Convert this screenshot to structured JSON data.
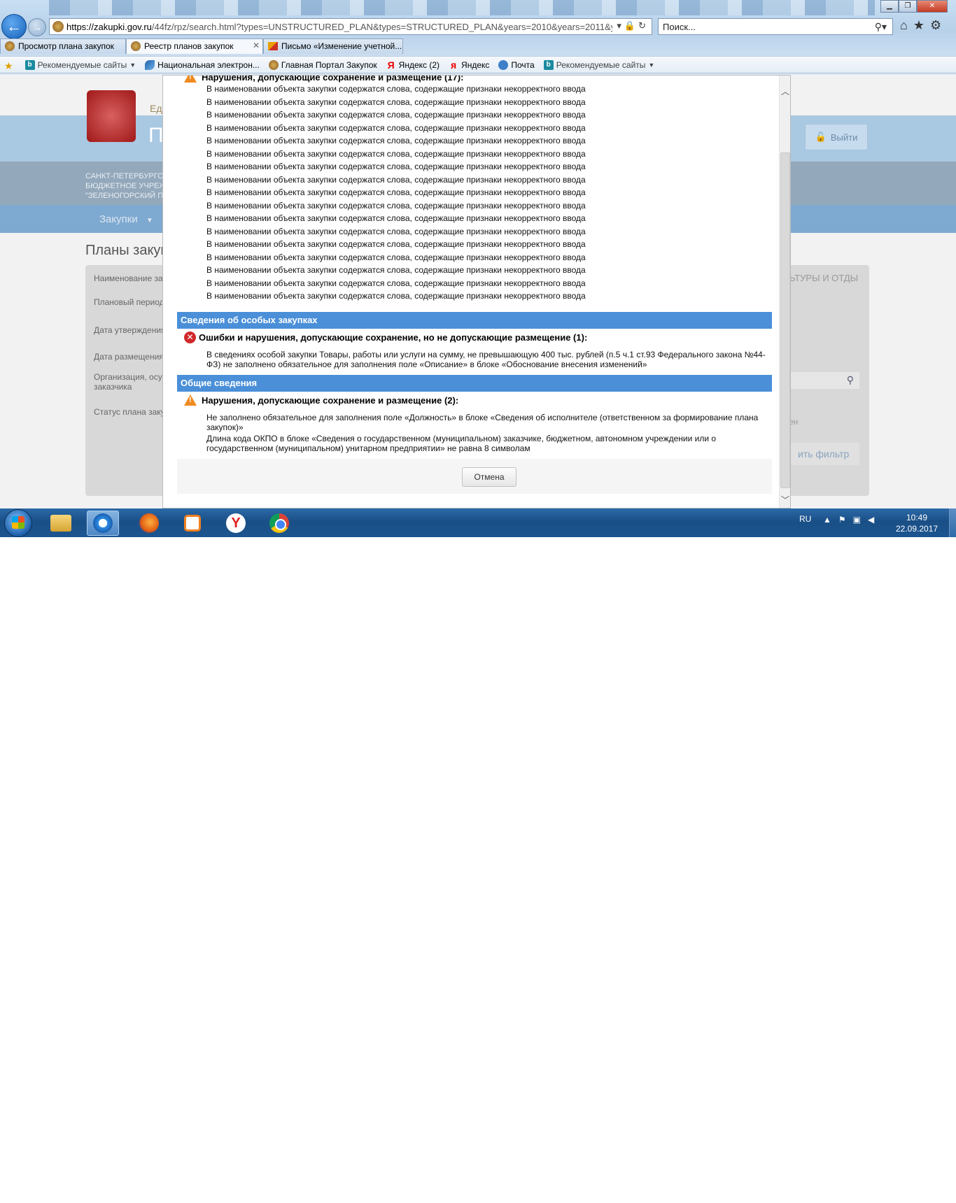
{
  "browser": {
    "url_host": "https://zakupki.gov.ru",
    "url_path": "/44fz/rpz/search.html?types=UNSTRUCTURED_PLAN&types=STRUCTURED_PLAN&years=2010&years=2011&years=2012&yea",
    "search_placeholder": "Поиск...",
    "tabs": [
      {
        "label": "Просмотр плана закупок",
        "active": false
      },
      {
        "label": "Реестр планов закупок",
        "active": true
      },
      {
        "label": "Письмо «Изменение учетной...",
        "active": false
      }
    ],
    "favorites": [
      {
        "label": "Рекомендуемые сайты",
        "icon": "bing-icon",
        "dropdown": true
      },
      {
        "label": "Национальная электрон...",
        "icon": "national-icon",
        "dropdown": false
      },
      {
        "label": "Главная Портал Закупок",
        "icon": "gerb-icon",
        "dropdown": false
      },
      {
        "label": "Яндекс (2)",
        "icon": "yandex-icon",
        "dropdown": false
      },
      {
        "label": "Яндекс",
        "icon": "yandex-icon",
        "dropdown": false
      },
      {
        "label": "Почта",
        "icon": "mail-icon",
        "dropdown": false
      },
      {
        "label": "Рекомендуемые сайты",
        "icon": "bing-icon",
        "dropdown": true
      }
    ]
  },
  "background_page": {
    "header_ed": "Ед",
    "header_p": "П",
    "logout_label": "Выйти",
    "org_lines": [
      "САНКТ-ПЕТЕРБУРГС",
      "БЮДЖЕТНОЕ УЧРЕЖ",
      "\"ЗЕЛЕНОГОРСКИЙ П"
    ],
    "menu_zakupki": "Закупки",
    "page_title": "Планы закуп",
    "filter_labels": [
      "Наименование зак",
      "Плановый период",
      "Дата утверждения",
      "Дата размещения",
      "Организация, осу",
      "заказчика",
      "Статус плана заку"
    ],
    "filter_right_text": "ЬТУРЫ И ОТДЫ",
    "filter_den": "ден",
    "apply_filter_label": "ить фильтр"
  },
  "modal": {
    "section1_title": "Нарушения, допускающие сохранение и размещение (17):",
    "violation_item": "В наименовании объекта закупки содержатся слова, содержащие признаки некорректного ввода",
    "violation_items": [
      "В наименовании объекта закупки содержатся слова, содержащие признаки некорректного ввода",
      "В наименовании объекта закупки содержатся слова, содержащие признаки некорректного ввода",
      "В наименовании объекта закупки содержатся слова, содержащие признаки некорректного ввода",
      "В наименовании объекта закупки содержатся слова, содержащие признаки некорректного ввода",
      "В наименовании объекта закупки содержатся слова, содержащие признаки некорректного ввода",
      "В наименовании объекта закупки содержатся слова, содержащие признаки некорректного ввода",
      "В наименовании объекта закупки содержатся слова, содержащие признаки некорректного ввода",
      "В наименовании объекта закупки содержатся слова, содержащие признаки некорректного ввода",
      "В наименовании объекта закупки содержатся слова, содержащие признаки некорректного ввода",
      "В наименовании объекта закупки содержатся слова, содержащие признаки некорректного ввода",
      "В наименовании объекта закупки содержатся слова, содержащие признаки некорректного ввода",
      "В наименовании объекта закупки содержатся слова, содержащие признаки некорректного ввода",
      "В наименовании объекта закупки содержатся слова, содержащие признаки некорректного ввода",
      "В наименовании объекта закупки содержатся слова, содержащие признаки некорректного ввода",
      "В наименовании объекта закупки содержатся слова, содержащие признаки некорректного ввода",
      "В наименовании объекта закупки содержатся слова, содержащие признаки некорректного ввода",
      "В наименовании объекта закупки содержатся слова, содержащие признаки некорректного ввода"
    ],
    "section_special_title": "Сведения об особых закупках",
    "errors_title": "Ошибки и нарушения, допускающие сохранение, но не допускающие размещение (1):",
    "errors_text": "В сведениях особой закупки Товары, работы или услуги на сумму, не превышающую 400 тыс. рублей (п.5 ч.1 ст.93 Федерального закона №44-ФЗ) не заполнено обязательное для заполнения поле «Описание» в блоке «Обоснование внесения изменений»",
    "section_general_title": "Общие сведения",
    "general_warn_title": "Нарушения, допускающие сохранение и размещение (2):",
    "general_items": [
      "Не заполнено обязательное для заполнения поле «Должность» в блоке «Сведения об исполнителе (ответственном за формирование плана закупок)»",
      "Длина кода ОКПО в блоке «Сведения о государственном (муниципальном) заказчике, бюджетном, автономном учреждении или о государственном (муниципальном) унитарном предприятии» не равна 8 символам"
    ],
    "cancel_label": "Отмена"
  },
  "taskbar": {
    "lang": "RU",
    "time": "10:49",
    "date": "22.09.2017"
  }
}
